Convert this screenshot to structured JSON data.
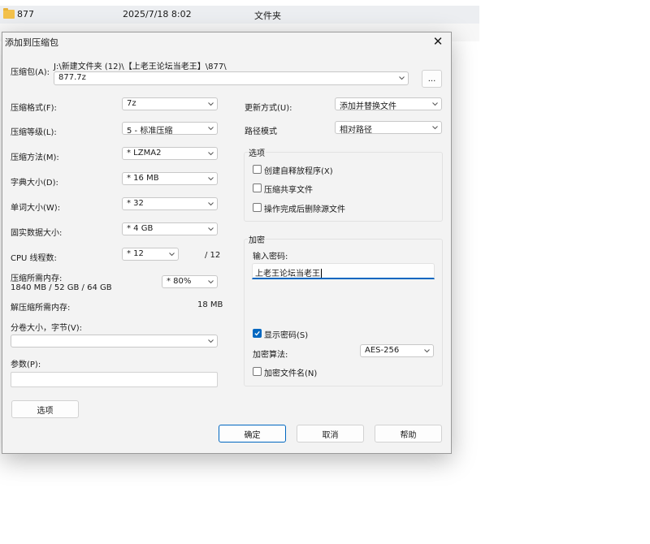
{
  "background": {
    "row1": {
      "name": "877",
      "date": "2025/7/18 8:02",
      "type": "文件夹"
    }
  },
  "dialog": {
    "title": "添加到压缩包",
    "close_glyph": "✕",
    "archive": {
      "label": "压缩包(A):",
      "path": "J:\\新建文件夹 (12)\\【上老王论坛当老王】\\877\\",
      "name": "877.7z",
      "browse_label": "..."
    },
    "left": {
      "format": {
        "label": "压缩格式(F):",
        "value": "7z"
      },
      "level": {
        "label": "压缩等级(L):",
        "value": "5 - 标准压缩"
      },
      "method": {
        "label": "压缩方法(M):",
        "value": "* LZMA2"
      },
      "dict": {
        "label": "字典大小(D):",
        "value": "* 16 MB"
      },
      "word": {
        "label": "单词大小(W):",
        "value": "* 32"
      },
      "solid": {
        "label": "固实数据大小:",
        "value": "* 4 GB"
      },
      "threads": {
        "label": "CPU 线程数:",
        "value": "* 12",
        "max": "/ 12"
      },
      "mem": {
        "label": "压缩所需内存:",
        "detail": "1840 MB / 52 GB / 64 GB",
        "value": "* 80%"
      },
      "decomp": {
        "label": "解压缩所需内存:",
        "value": "18 MB"
      },
      "volume": {
        "label": "分卷大小，字节(V):",
        "value": ""
      },
      "params": {
        "label": "参数(P):",
        "value": ""
      },
      "options_button": "选项"
    },
    "right": {
      "update": {
        "label": "更新方式(U):",
        "value": "添加并替换文件"
      },
      "path_mode": {
        "label": "路径模式",
        "value": "相对路径"
      },
      "options": {
        "title": "选项",
        "sfx": "创建自释放程序(X)",
        "shared": "压缩共享文件",
        "delete": "操作完成后删除源文件"
      },
      "encryption": {
        "title": "加密",
        "password_label": "输入密码:",
        "password_value": "上老王论坛当老王",
        "show_password": "显示密码(S)",
        "method_label": "加密算法:",
        "method_value": "AES-256",
        "encrypt_names": "加密文件名(N)"
      }
    },
    "buttons": {
      "ok": "确定",
      "cancel": "取消",
      "help": "帮助"
    }
  },
  "colors": {
    "accent": "#0067c0",
    "folder": "#f3c14b"
  },
  "state": {
    "sfx": false,
    "shared": false,
    "delete": false,
    "show_password": true,
    "encrypt_names": false
  }
}
